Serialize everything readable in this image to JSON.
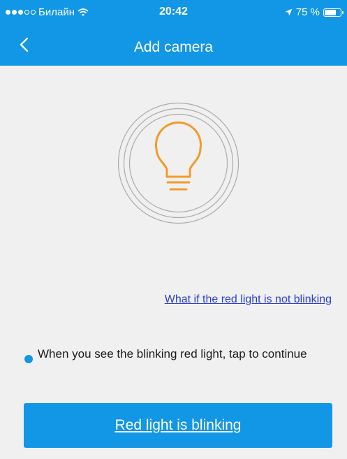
{
  "status_bar": {
    "carrier": "Билайн",
    "time": "20:42",
    "battery": "75 %",
    "battery_level": 0.75,
    "icons": [
      "signal-dots-icon",
      "wifi-icon",
      "location-arrow-icon",
      "battery-icon"
    ]
  },
  "header": {
    "title": "Add camera",
    "back_icon": "chevron-left-icon"
  },
  "illustration": {
    "icon": "light-bulb-icon",
    "bulb_color": "#f39a2b",
    "ring_color": "#aaaaaa"
  },
  "help": {
    "link_text": "What if the red light is not blinking"
  },
  "instruction": {
    "text": "When you see the blinking red light, tap to continue"
  },
  "action": {
    "button_label": "Red light is blinking"
  },
  "colors": {
    "accent": "#1296e6",
    "background": "#f0f0f0",
    "link": "#2a3fd1"
  }
}
